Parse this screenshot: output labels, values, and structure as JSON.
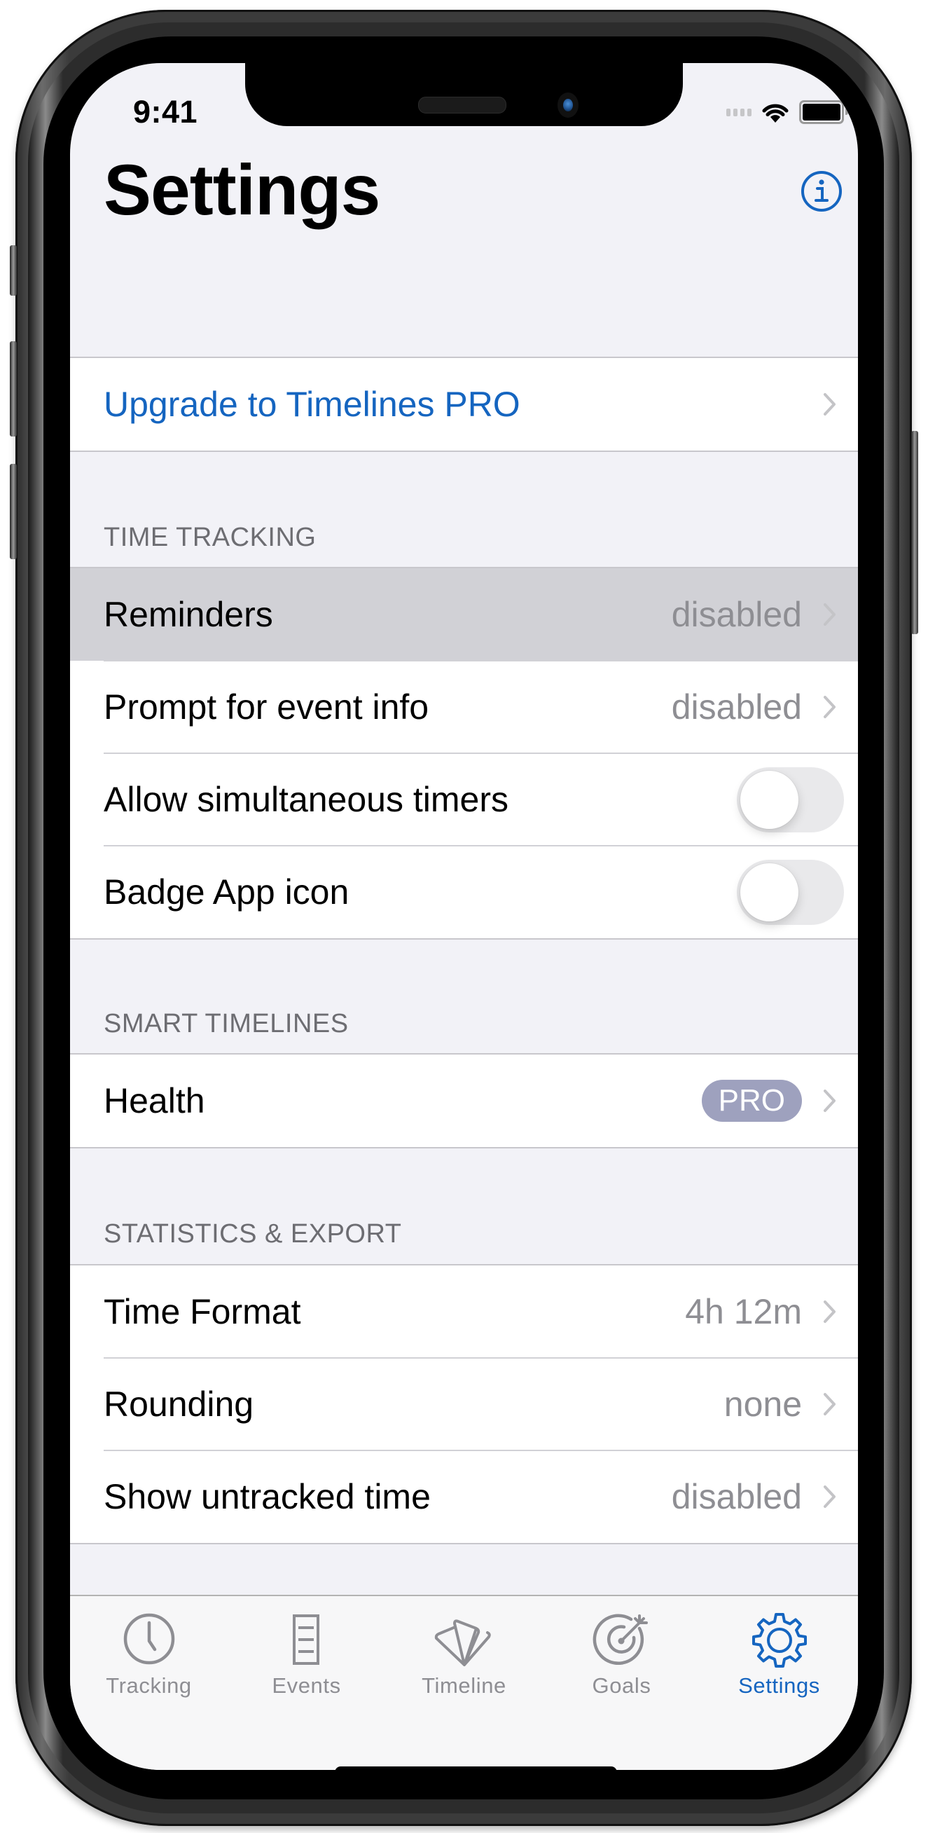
{
  "status_bar": {
    "time": "9:41",
    "icons": [
      "signal-icon",
      "wifi-icon",
      "battery-icon"
    ]
  },
  "nav": {
    "title": "Settings",
    "info_icon": "info-circle-icon"
  },
  "colors": {
    "accent": "#1565c0",
    "pro_badge": "#9ea1be",
    "secondary_text": "#8e8e93",
    "header_text": "#6d6d72",
    "background": "#f2f2f7",
    "highlight": "#d1d1d6"
  },
  "upgrade": {
    "label": "Upgrade to Timelines PRO"
  },
  "sections": [
    {
      "header": "TIME TRACKING",
      "rows": [
        {
          "label": "Reminders",
          "value": "disabled",
          "type": "disclosure",
          "highlighted": true
        },
        {
          "label": "Prompt for event info",
          "value": "disabled",
          "type": "disclosure"
        },
        {
          "label": "Allow simultaneous timers",
          "type": "toggle",
          "on": false
        },
        {
          "label": "Badge App icon",
          "type": "toggle",
          "on": false
        }
      ]
    },
    {
      "header": "SMART TIMELINES",
      "rows": [
        {
          "label": "Health",
          "badge": "PRO",
          "type": "disclosure"
        }
      ]
    },
    {
      "header": "STATISTICS & EXPORT",
      "rows": [
        {
          "label": "Time Format",
          "value": "4h 12m",
          "type": "disclosure"
        },
        {
          "label": "Rounding",
          "value": "none",
          "type": "disclosure"
        },
        {
          "label": "Show untracked time",
          "value": "disabled",
          "type": "disclosure"
        }
      ]
    }
  ],
  "tabbar": {
    "active": "Settings",
    "tabs": [
      {
        "label": "Tracking",
        "icon": "clock-icon"
      },
      {
        "label": "Events",
        "icon": "document-list-icon"
      },
      {
        "label": "Timeline",
        "icon": "fan-timeline-icon"
      },
      {
        "label": "Goals",
        "icon": "target-arrow-icon"
      },
      {
        "label": "Settings",
        "icon": "gear-icon"
      }
    ]
  }
}
